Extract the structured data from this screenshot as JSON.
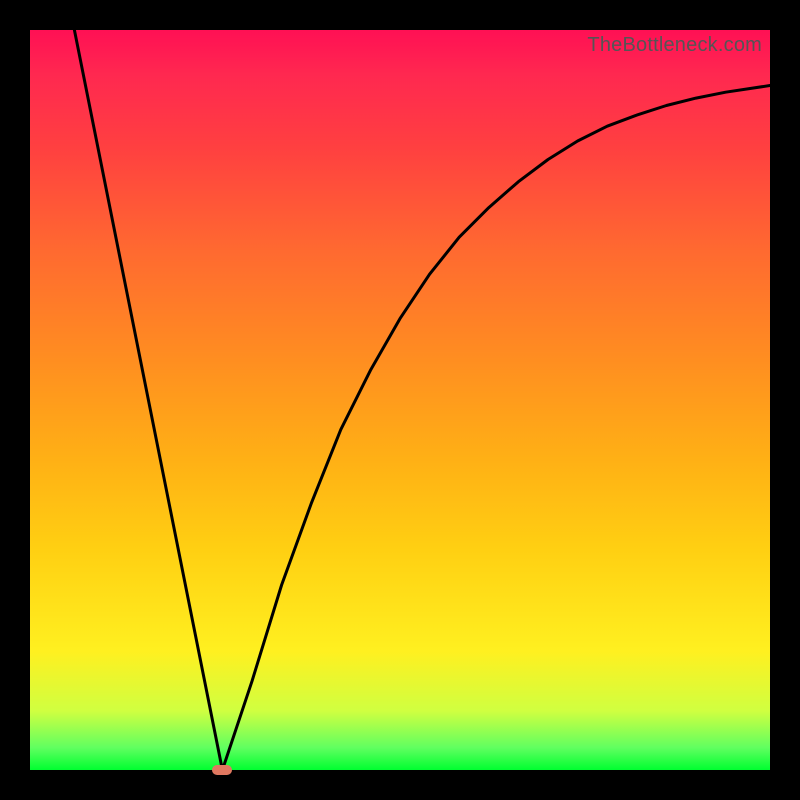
{
  "watermark": "TheBottleneck.com",
  "colors": {
    "background": "#000000",
    "gradient_top": "#ff1054",
    "gradient_bottom": "#00ff30",
    "curve": "#000000",
    "marker": "#e07860"
  },
  "chart_data": {
    "type": "line",
    "title": "",
    "xlabel": "",
    "ylabel": "",
    "xlim": [
      0,
      1
    ],
    "ylim": [
      0,
      1
    ],
    "series": [
      {
        "name": "left-branch",
        "x": [
          0.06,
          0.26
        ],
        "y": [
          1.0,
          0.0
        ]
      },
      {
        "name": "right-branch",
        "x": [
          0.26,
          0.3,
          0.34,
          0.38,
          0.42,
          0.46,
          0.5,
          0.54,
          0.58,
          0.62,
          0.66,
          0.7,
          0.74,
          0.78,
          0.82,
          0.86,
          0.9,
          0.94,
          1.0
        ],
        "y": [
          0.0,
          0.12,
          0.25,
          0.36,
          0.46,
          0.54,
          0.61,
          0.67,
          0.72,
          0.76,
          0.795,
          0.825,
          0.85,
          0.87,
          0.885,
          0.898,
          0.908,
          0.916,
          0.925
        ]
      }
    ],
    "annotations": [
      {
        "name": "minimum-marker",
        "x": 0.26,
        "y": 0.0
      }
    ]
  }
}
